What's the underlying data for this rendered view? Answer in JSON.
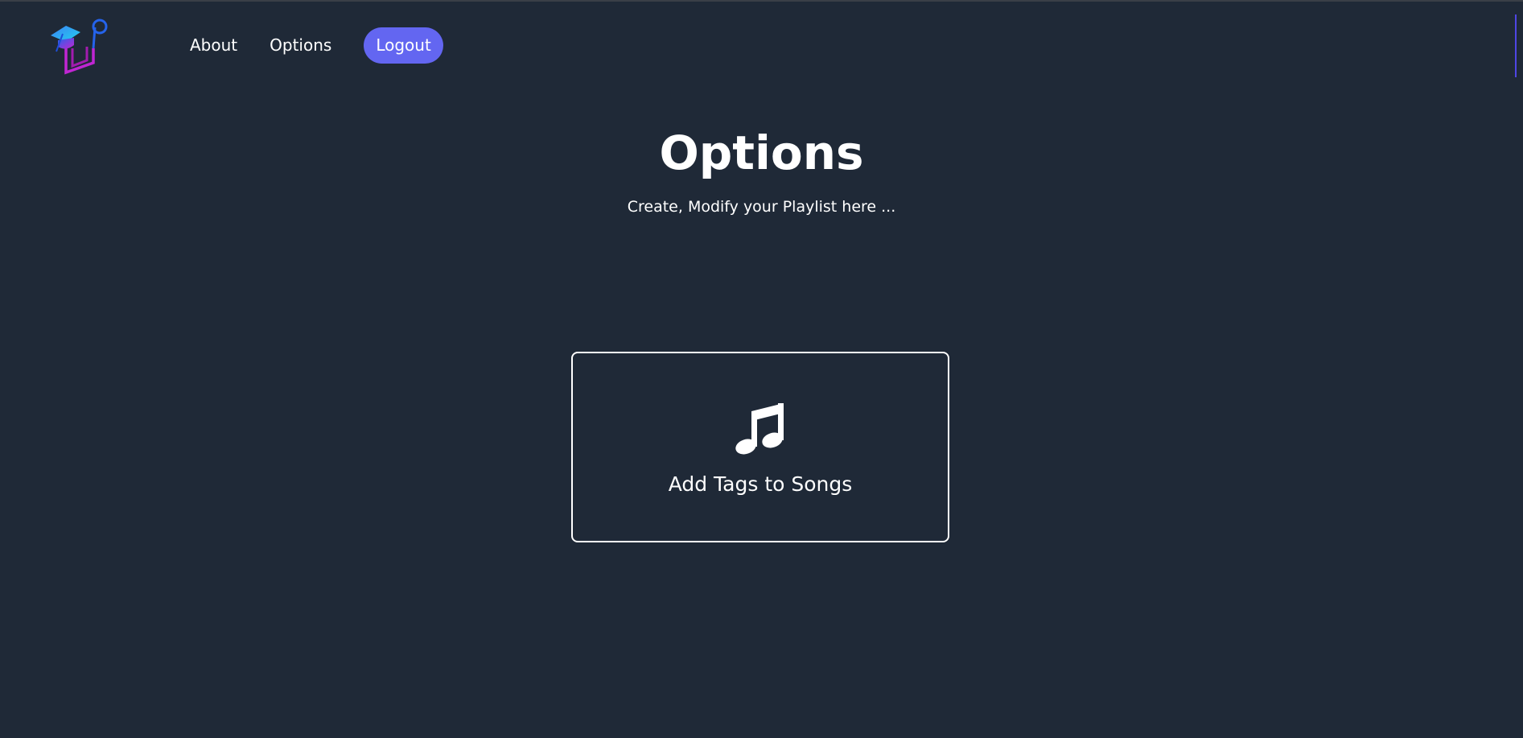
{
  "header": {
    "logo_icon": "headphones-graduation-logo-icon",
    "nav": {
      "about_label": "About",
      "options_label": "Options"
    },
    "logout_label": "Logout",
    "accent_color": "#6366f1"
  },
  "main": {
    "title": "Options",
    "subtitle": "Create, Modify your Playlist here ...",
    "cards": [
      {
        "icon": "music-note-icon",
        "label": "Add Tags to Songs"
      }
    ]
  },
  "colors": {
    "background": "#1f2937",
    "text": "#ffffff"
  }
}
